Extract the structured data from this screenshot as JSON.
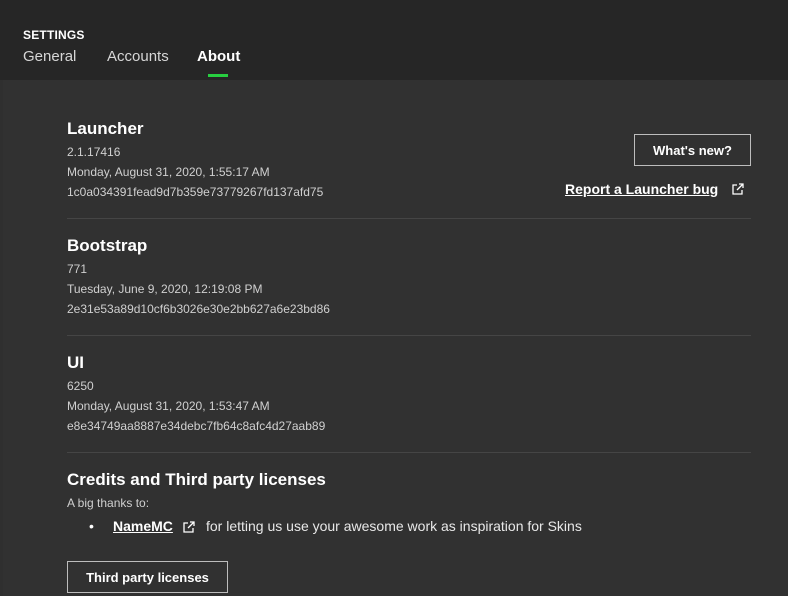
{
  "header": {
    "section_label": "SETTINGS",
    "tabs": [
      {
        "label": "General",
        "active": false
      },
      {
        "label": "Accounts",
        "active": false
      },
      {
        "label": "About",
        "active": true
      }
    ]
  },
  "launcher": {
    "title": "Launcher",
    "version": "2.1.17416",
    "date": "Monday, August 31, 2020, 1:55:17 AM",
    "hash": "1c0a034391fead9d7b359e73779267fd137afd75",
    "whats_new_label": "What's new?",
    "report_bug_label": "Report a Launcher bug"
  },
  "bootstrap": {
    "title": "Bootstrap",
    "version": "771",
    "date": "Tuesday, June 9, 2020, 12:19:08 PM",
    "hash": "2e31e53a89d10cf6b3026e30e2bb627a6e23bd86"
  },
  "ui": {
    "title": "UI",
    "version": "6250",
    "date": "Monday, August 31, 2020, 1:53:47 AM",
    "hash": "e8e34749aa8887e34debc7fb64c8afc4d27aab89"
  },
  "credits": {
    "title": "Credits and Third party licenses",
    "subtitle": "A big thanks to:",
    "items": [
      {
        "bullet": "•",
        "link": "NameMC",
        "text": "for letting us use your awesome work as inspiration for Skins"
      }
    ],
    "licenses_button_label": "Third party licenses"
  },
  "colors": {
    "accent": "#27ce40",
    "header_bg": "#262626",
    "main_bg": "#313131"
  },
  "icons": {
    "external_link": "external-link-icon"
  }
}
